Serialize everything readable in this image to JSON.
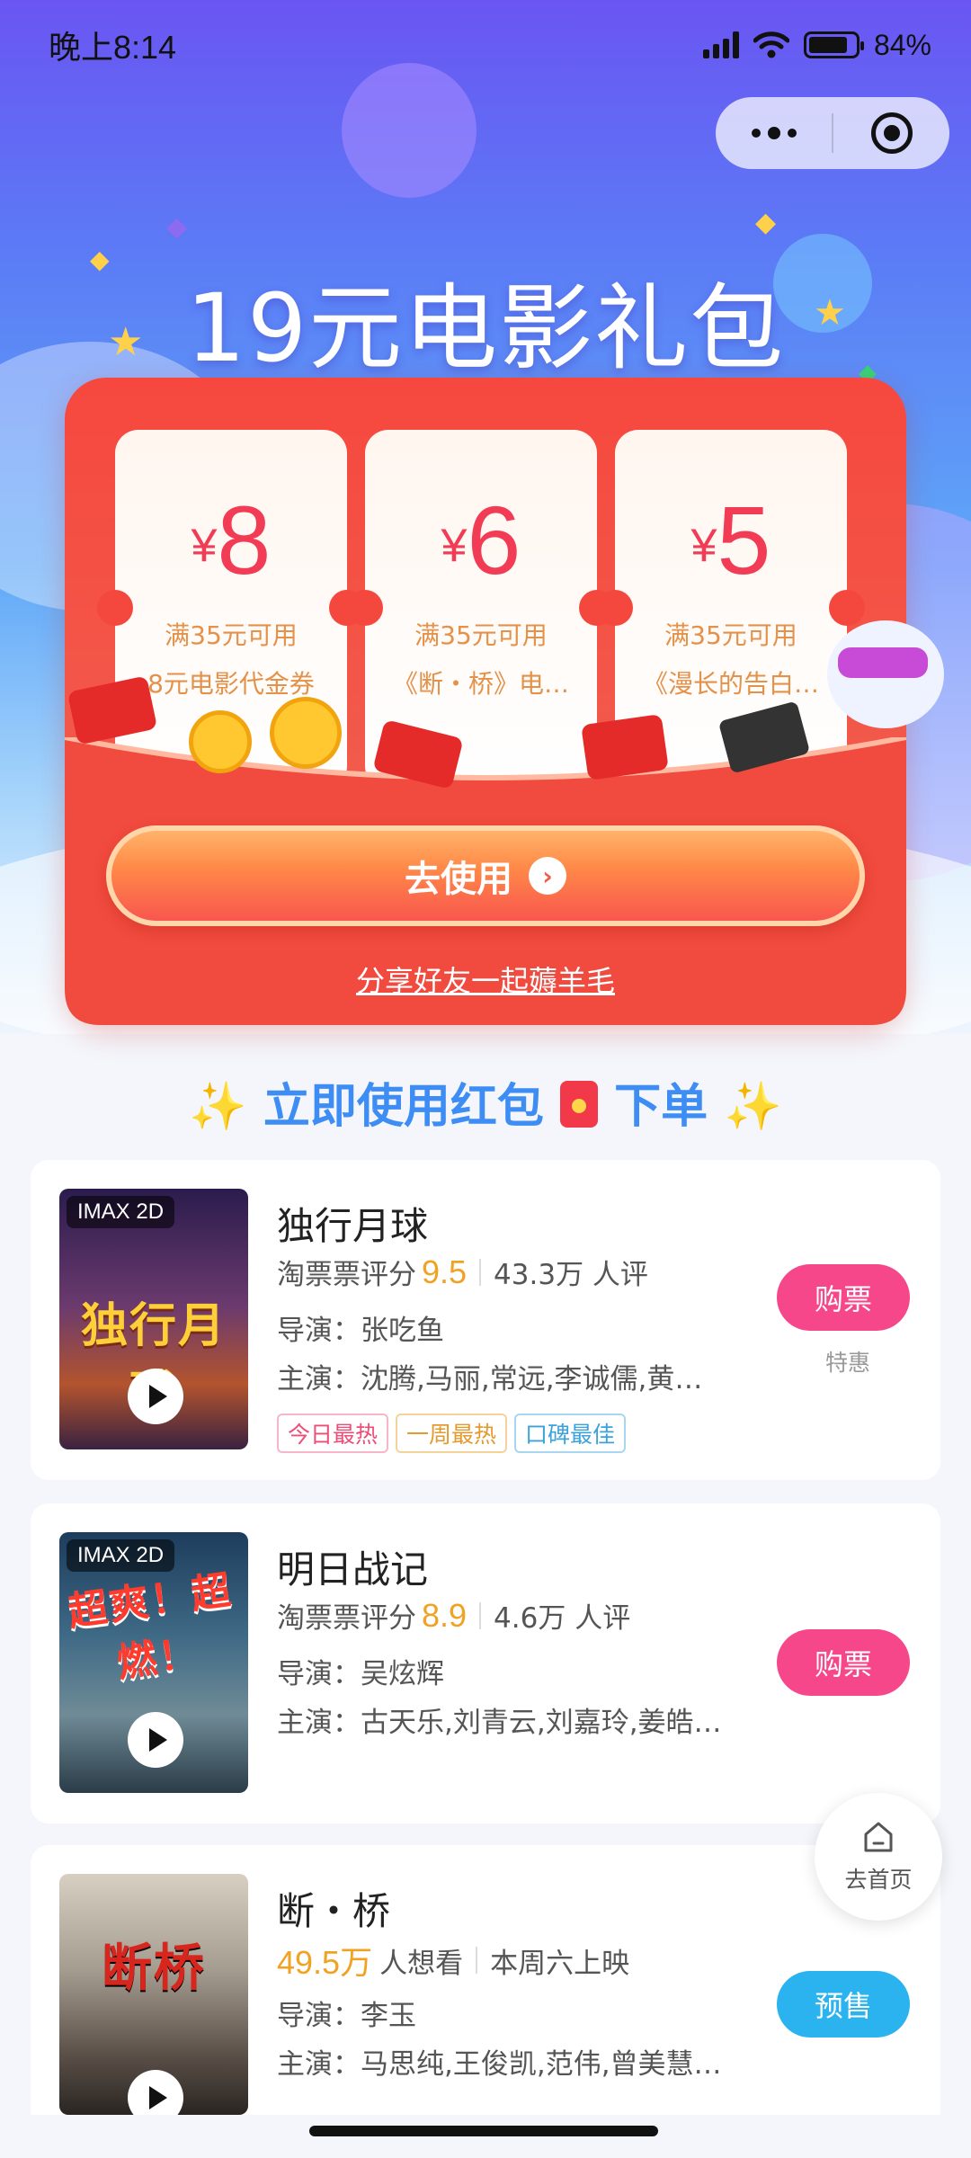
{
  "status_bar": {
    "time": "晚上8:14",
    "battery": "84%",
    "battery_level": 0.84
  },
  "capsule": {
    "more_icon": "more-dots-icon",
    "close_icon": "target-circle-icon"
  },
  "hero": {
    "title": "19元电影礼包",
    "coupons": [
      {
        "currency": "¥",
        "amount": "8",
        "condition": "满35元可用",
        "description": "8元电影代金券"
      },
      {
        "currency": "¥",
        "amount": "6",
        "condition": "满35元可用",
        "description": "《断・桥》电…"
      },
      {
        "currency": "¥",
        "amount": "5",
        "condition": "满35元可用",
        "description": "《漫长的告白…"
      }
    ],
    "use_button": "去使用",
    "share_link": "分享好友一起薅羊毛"
  },
  "section": {
    "title": "立即使用红包",
    "title_suffix": "下单",
    "spark": "✨"
  },
  "movies": [
    {
      "title": "独行月球",
      "badge": "IMAX 2D",
      "poster_text": "独行月球",
      "score_label": "淘票票评分",
      "score": "9.5",
      "reviews": "43.3万 人评",
      "director": "导演：张吃鱼",
      "cast": "主演：沈腾,马丽,常远,李诚儒,黄…",
      "tags": [
        "今日最热",
        "一周最热",
        "口碑最佳"
      ],
      "button": "购票",
      "note": "特惠"
    },
    {
      "title": "明日战记",
      "badge": "IMAX 2D",
      "poster_text": "超爽！超燃！",
      "score_label": "淘票票评分",
      "score": "8.9",
      "reviews": "4.6万 人评",
      "director": "导演：吴炫辉",
      "cast": "主演：古天乐,刘青云,刘嘉玲,姜皓…",
      "button": "购票"
    },
    {
      "title": "断・桥",
      "poster_text": "断桥",
      "want_count": "49.5万",
      "want_label": "人想看",
      "release": "本周六上映",
      "director": "导演：李玉",
      "cast": "主演：马思纯,王俊凯,范伟,曾美慧…",
      "button": "预售"
    }
  ],
  "home_fab": {
    "label": "去首页",
    "icon": "home-icon"
  },
  "colors": {
    "accent_red": "#f6483e",
    "buy_pink": "#f7478b",
    "presale_blue": "#2ab3ef",
    "score_orange": "#f0a323",
    "section_blue": "#3d8df5"
  }
}
